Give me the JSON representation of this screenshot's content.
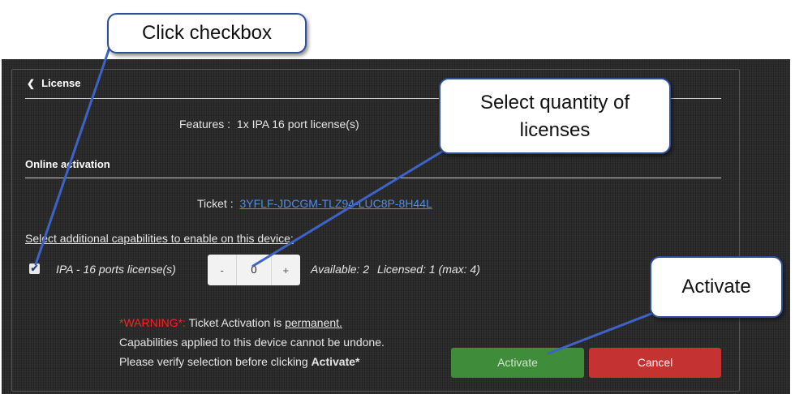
{
  "license": {
    "header": "License",
    "features_label": "Features :",
    "features_value": "1x IPA 16 port license(s)",
    "online_header": "Online activation",
    "ticket_label": "Ticket :",
    "ticket_value": "3YFLF-JDCGM-TLZ94-LUC8P-8H44L",
    "select_prompt": "Select additional capabilities to enable on this device:",
    "capability": {
      "label": "IPA - 16 ports license(s)",
      "checked": true,
      "minus": "-",
      "quantity": "0",
      "plus": "+",
      "available": "Available: 2",
      "licensed": "Licensed: 1 (max: 4)"
    },
    "warning": {
      "tag": "*WARNING*:",
      "line1_rest": " Ticket Activation is ",
      "permanent": "permanent.",
      "line2": "Capabilities applied to this device cannot be undone.",
      "line3_pre": "Please verify selection before clicking ",
      "line3_bold": "Activate*"
    },
    "buttons": {
      "activate": "Activate",
      "cancel": "Cancel"
    }
  },
  "callouts": {
    "checkbox": "Click checkbox",
    "quantity_line1": "Select quantity of",
    "quantity_line2": "licenses",
    "activate": "Activate"
  },
  "colors": {
    "activate": "#3f8d3a",
    "cancel": "#c53232",
    "link": "#4a8ef0",
    "warning": "#ff2020",
    "callout_border": "#2f4f9e"
  }
}
